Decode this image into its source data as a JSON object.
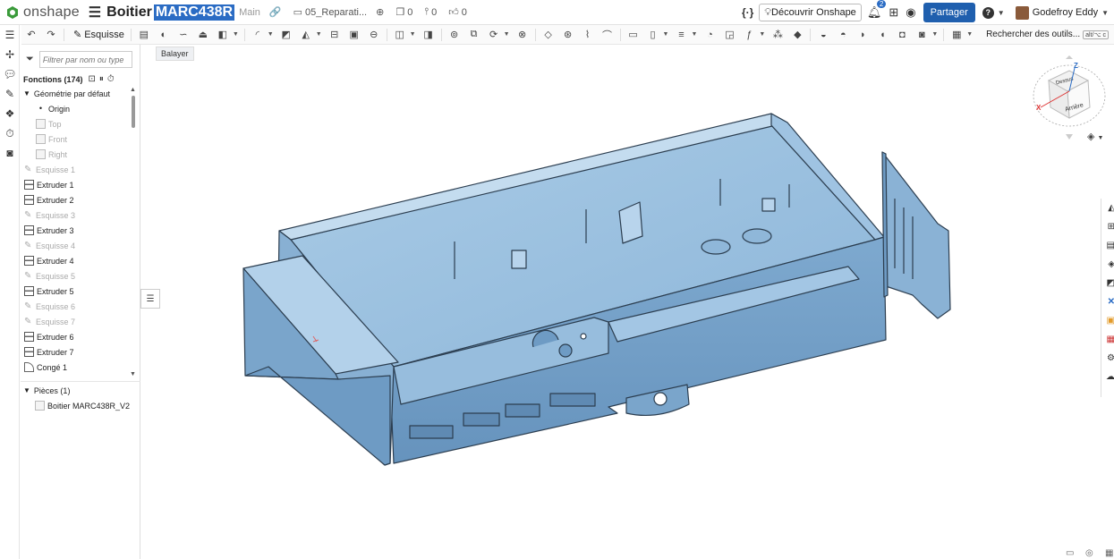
{
  "topbar": {
    "app_name": "onshape",
    "doc_title": "Boitier",
    "doc_title_selected": "MARC438R",
    "branch": "Main",
    "folder": "05_Reparati...",
    "versions_count": "0",
    "branches_count": "0",
    "likes_count": "0",
    "json_label": "{·}",
    "discover_label": "Découvrir Onshape",
    "notification_count": "2",
    "share_label": "Partager",
    "help_label": "?",
    "user_name": "Godefroy Eddy"
  },
  "toolbar": {
    "sketch_label": "Esquisse",
    "search_tools_label": "Rechercher des outils...",
    "search_shortcut": "alt/⌥ c"
  },
  "tooltip": {
    "text": "Balayer"
  },
  "feature_panel": {
    "filter_placeholder": "Filtrer par nom ou type",
    "features_header": "Fonctions (174)",
    "default_geometry_label": "Géométrie par défaut",
    "items": [
      {
        "label": "Origin",
        "type": "origin",
        "dim": false,
        "indent": 2
      },
      {
        "label": "Top",
        "type": "plane",
        "dim": true,
        "indent": 2
      },
      {
        "label": "Front",
        "type": "plane",
        "dim": true,
        "indent": 2
      },
      {
        "label": "Right",
        "type": "plane",
        "dim": true,
        "indent": 2
      },
      {
        "label": "Esquisse 1",
        "type": "sketch",
        "dim": true,
        "indent": 1
      },
      {
        "label": "Extruder 1",
        "type": "extrude",
        "dim": false,
        "indent": 1
      },
      {
        "label": "Extruder 2",
        "type": "extrude",
        "dim": false,
        "indent": 1
      },
      {
        "label": "Esquisse 3",
        "type": "sketch",
        "dim": true,
        "indent": 1
      },
      {
        "label": "Extruder 3",
        "type": "extrude",
        "dim": false,
        "indent": 1
      },
      {
        "label": "Esquisse 4",
        "type": "sketch",
        "dim": true,
        "indent": 1
      },
      {
        "label": "Extruder 4",
        "type": "extrude",
        "dim": false,
        "indent": 1
      },
      {
        "label": "Esquisse 5",
        "type": "sketch",
        "dim": true,
        "indent": 1
      },
      {
        "label": "Extruder 5",
        "type": "extrude",
        "dim": false,
        "indent": 1
      },
      {
        "label": "Esquisse 6",
        "type": "sketch",
        "dim": true,
        "indent": 1
      },
      {
        "label": "Esquisse 7",
        "type": "sketch",
        "dim": true,
        "indent": 1
      },
      {
        "label": "Extruder 6",
        "type": "extrude",
        "dim": false,
        "indent": 1
      },
      {
        "label": "Extruder 7",
        "type": "extrude",
        "dim": false,
        "indent": 1
      },
      {
        "label": "Congé 1",
        "type": "fillet",
        "dim": false,
        "indent": 1
      }
    ],
    "parts_header": "Pièces (1)",
    "part_name": "Boitier MARC438R_V2"
  },
  "viewcube": {
    "top_face": "Dessus",
    "back_face": "Arrière",
    "axis_z": "Z",
    "axis_x": "X"
  }
}
